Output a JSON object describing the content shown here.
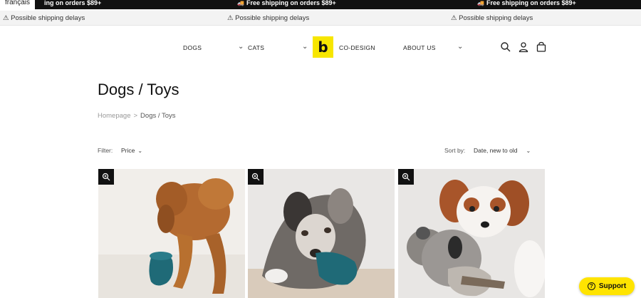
{
  "announcement": {
    "language": "français",
    "shipping_text": "Free shipping on orders $89+",
    "shipping_text_clipped": "ing on orders $89+",
    "truck_glyph": "🚚",
    "notice_text": "⚠ Possible shipping delays"
  },
  "nav": {
    "items": [
      "DOGS",
      "CATS",
      "CO-DESIGN",
      "ABOUT US"
    ],
    "logo_letter": "b",
    "logo_color": "#f7e600",
    "icons": [
      "search-icon",
      "account-icon",
      "cart-icon"
    ]
  },
  "page": {
    "title": "Dogs / Toys",
    "breadcrumb": {
      "home": "Homepage",
      "separator": ">",
      "current": "Dogs / Toys"
    }
  },
  "toolbar": {
    "filter_label": "Filter:",
    "filter_value": "Price",
    "sort_label": "Sort by:",
    "sort_value": "Date, new to old"
  },
  "products": [
    {
      "image": "red poodle puppy playing with teal treat toy",
      "zoom_icon": "zoom-icon"
    },
    {
      "image": "merle dog chewing teal toy",
      "zoom_icon": "zoom-icon"
    },
    {
      "image": "cavalier spaniel hugging plush koala toy",
      "zoom_icon": "zoom-icon"
    }
  ],
  "support": {
    "label": "Support",
    "icon": "?"
  },
  "colors": {
    "accent": "#ffe400",
    "topbar": "#111111"
  }
}
